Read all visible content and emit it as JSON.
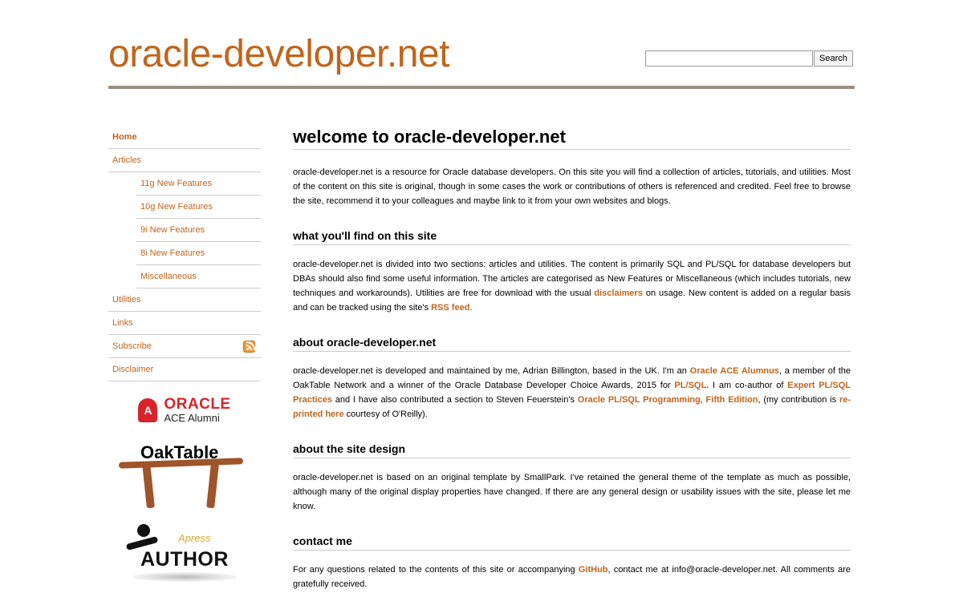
{
  "header": {
    "site_title": "oracle-developer.net",
    "search_placeholder": "",
    "search_button": "Search"
  },
  "colors": {
    "accent": "#c0651c",
    "rule": "#9c8f82"
  },
  "nav": {
    "home": "Home",
    "articles": "Articles",
    "sub_11g": "11g New Features",
    "sub_10g": "10g New Features",
    "sub_9i": "9i New Features",
    "sub_8i": "8i New Features",
    "sub_misc": "Miscellaneous",
    "utilities": "Utilities",
    "links": "Links",
    "subscribe": "Subscribe",
    "disclaimer": "Disclaimer"
  },
  "badges": {
    "oracle_word": "ORACLE",
    "oracle_sub": "ACE Alumni",
    "oaktable": "OakTable",
    "apress_brand": "Apress",
    "apress_word": "AUTHOR"
  },
  "content": {
    "heading": "welcome to oracle-developer.net",
    "intro": "oracle-developer.net is a resource for Oracle database developers. On this site you will find a collection of articles, tutorials, and utilities. Most of the content on this site is original, though in some cases the work or contributions of others is referenced and credited. Feel free to browse the site, recommend it to your colleagues and maybe link to it from your own websites and blogs.",
    "find_heading": "what you'll find on this site",
    "find_p1": "oracle-developer.net is divided into two sections: articles and utilities. The content is primarily SQL and PL/SQL for database developers but DBAs should also find some useful information. The articles are categorised as New Features or Miscellaneous (which includes tutorials, new techniques and workarounds). Utilities are free for download with the usual ",
    "find_link1": "disclaimers",
    "find_p2": " on usage. New content is added on a regular basis and can be tracked using the site's ",
    "find_link2": "RSS feed",
    "find_p3": ".",
    "about_heading": "about oracle-developer.net",
    "about_p1": "oracle-developer.net is developed and maintained by me, Adrian Billington, based in the UK. I'm an ",
    "about_link1": "Oracle ACE Alumnus",
    "about_p2": ", a member of the OakTable Network and a winner of the Oracle Database Developer Choice Awards, 2015 for ",
    "about_link2": "PL/SQL",
    "about_p3": ". I am co-author of ",
    "about_link3": "Expert PL/SQL Practices",
    "about_p4": " and I have also contributed a section to Steven Feuerstein's ",
    "about_link4": "Oracle PL/SQL Programming, Fifth Edition",
    "about_p5": ", (my contribution is ",
    "about_link5": "re-printed here",
    "about_p6": " courtesy of O'Reilly).",
    "design_heading": "about the site design",
    "design_p": "oracle-developer.net is based on an original template by SmallPark. I've retained the general theme of the template as much as possible, although many of the original display properties have changed. If there are any general design or usability issues with the site, please let me know.",
    "contact_heading": "contact me",
    "contact_p1": "For any questions related to the contents of this site or accompanying ",
    "contact_link": "GitHub",
    "contact_p2": ", contact me at info@oracle-developer.net. All comments are gratefully received."
  }
}
